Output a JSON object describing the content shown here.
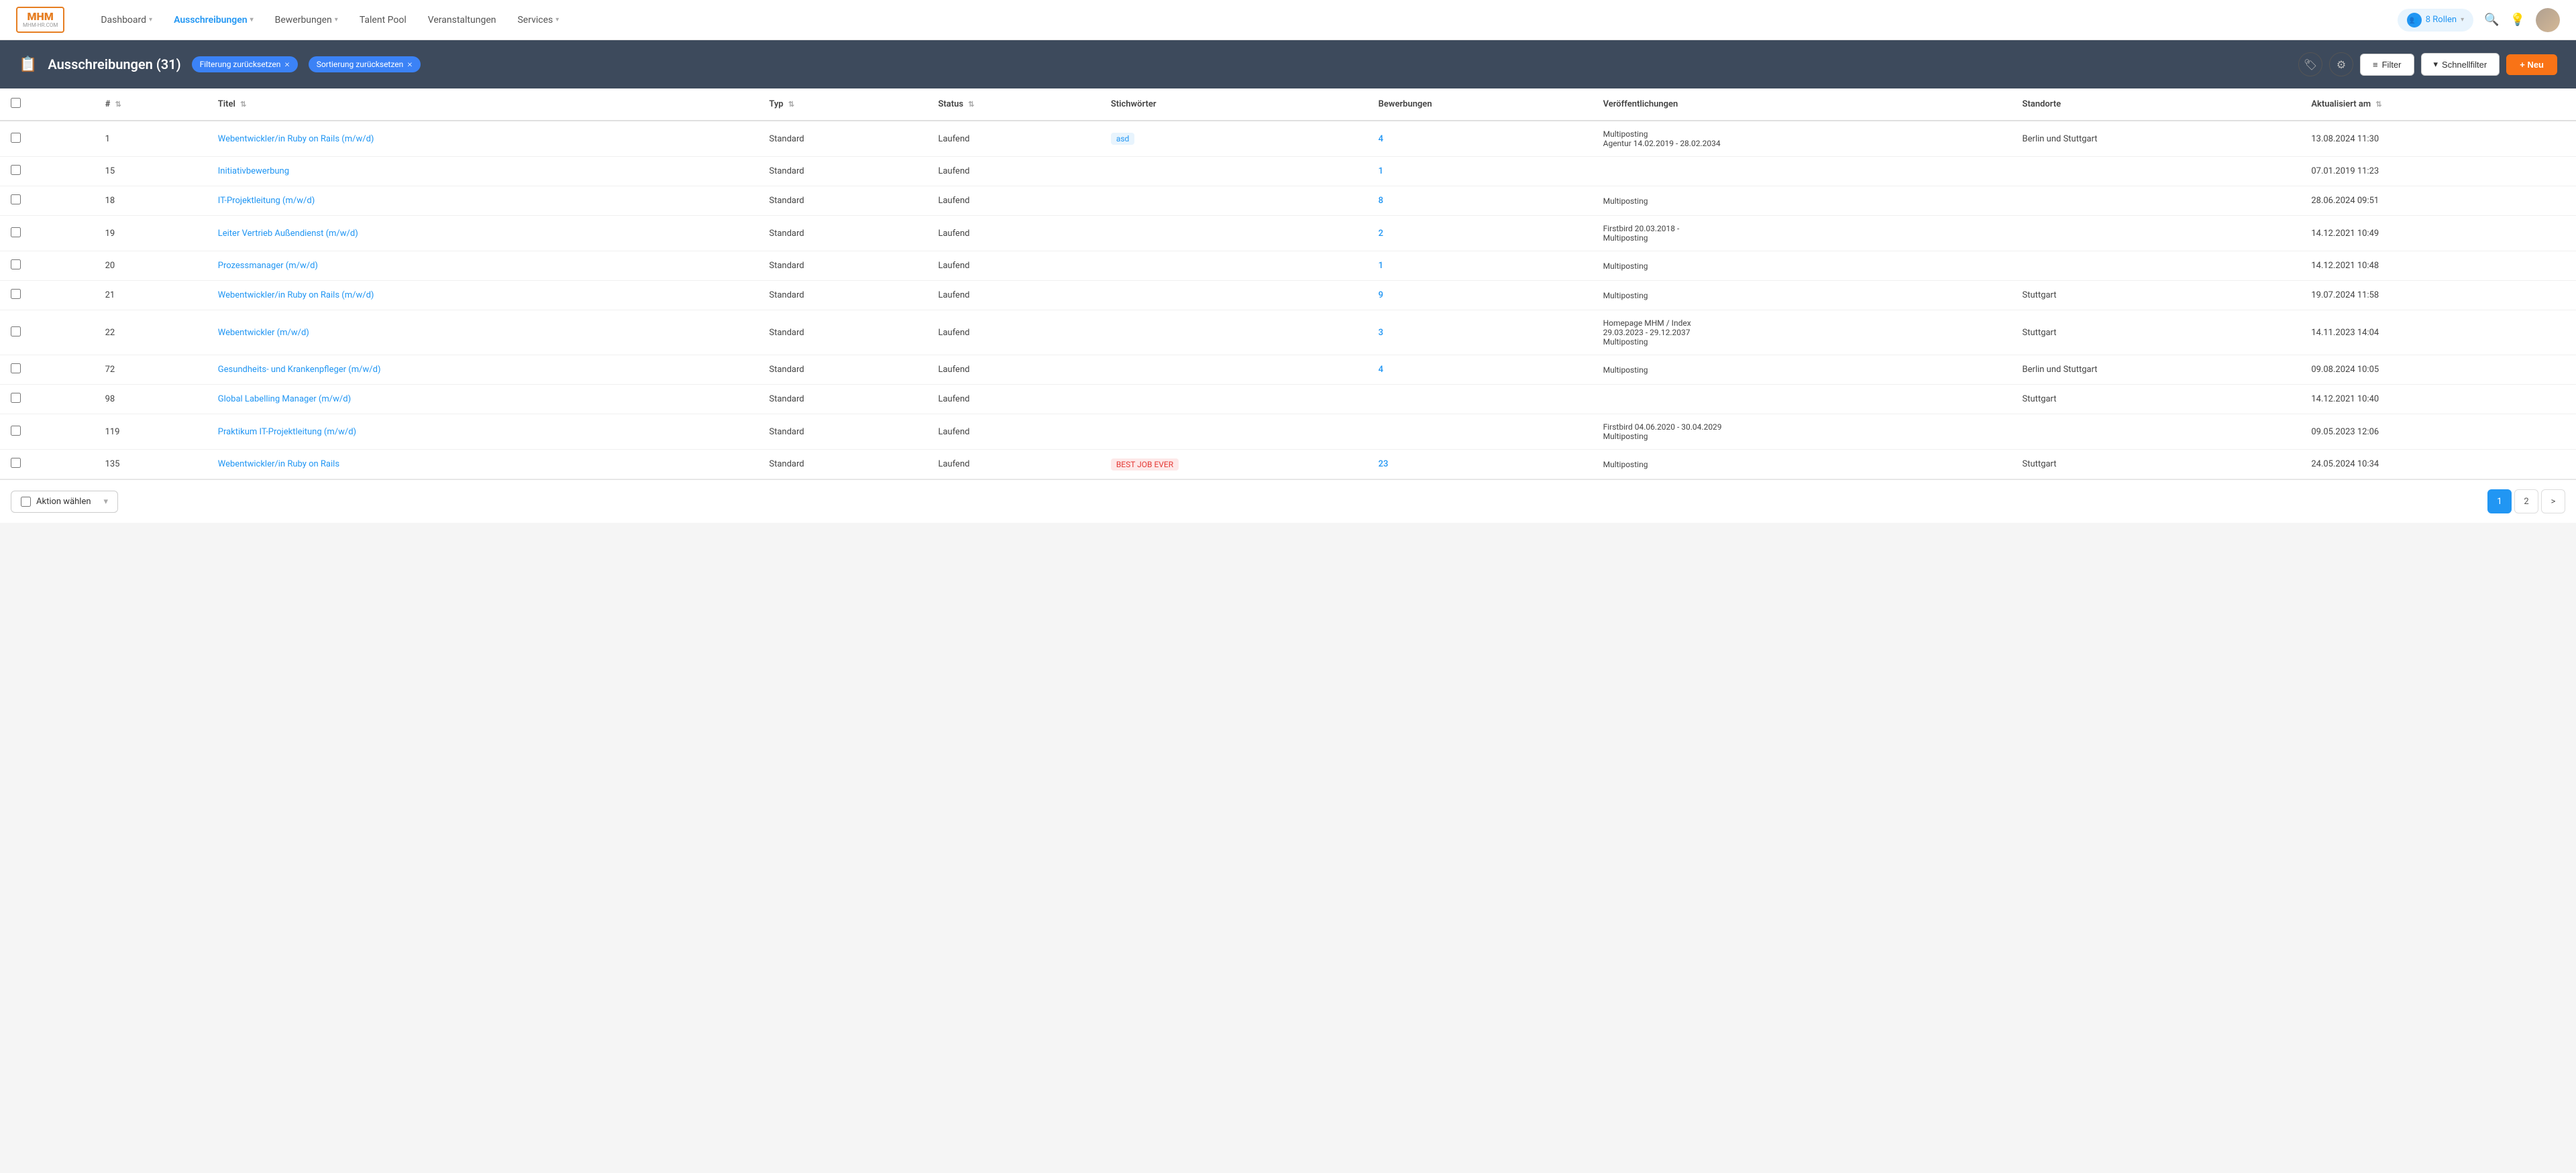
{
  "nav": {
    "logo_line1": "MHM",
    "logo_line2": "MHM-HR.COM",
    "links": [
      {
        "label": "Dashboard",
        "has_chevron": true,
        "active": false
      },
      {
        "label": "Ausschreibungen",
        "has_chevron": true,
        "active": true
      },
      {
        "label": "Bewerbungen",
        "has_chevron": true,
        "active": false
      },
      {
        "label": "Talent Pool",
        "has_chevron": false,
        "active": false
      },
      {
        "label": "Veranstaltungen",
        "has_chevron": false,
        "active": false
      },
      {
        "label": "Services",
        "has_chevron": true,
        "active": false
      }
    ],
    "roles_label": "8 Rollen"
  },
  "header": {
    "icon": "📋",
    "title": "Ausschreibungen (31)",
    "filter_reset_label": "Filterung zurücksetzen",
    "sort_reset_label": "Sortierung zurücksetzen",
    "filter_btn": "Filter",
    "schnell_btn": "Schnellfilter",
    "neu_btn": "+ Neu"
  },
  "table": {
    "columns": [
      "#",
      "Titel",
      "Typ",
      "Status",
      "Stichwörter",
      "Bewerbungen",
      "Veröffentlichungen",
      "Standorte",
      "Aktualisiert am"
    ],
    "rows": [
      {
        "id": "1",
        "title": "Webentwickler/in Ruby on Rails (m/w/d)",
        "typ": "Standard",
        "status": "Laufend",
        "stichwort": "asd",
        "stichwort_color": "blue",
        "bewerbungen": "4",
        "veroeffentlichungen": "Multiposting\nAgentur 14.02.2019 - 28.02.2034",
        "standorte": "Berlin und Stuttgart",
        "aktualisiert": "13.08.2024 11:30"
      },
      {
        "id": "15",
        "title": "Initiativbewerbung",
        "typ": "Standard",
        "status": "Laufend",
        "stichwort": "",
        "bewerbungen": "1",
        "veroeffentlichungen": "",
        "standorte": "",
        "aktualisiert": "07.01.2019 11:23"
      },
      {
        "id": "18",
        "title": "IT-Projektleitung (m/w/d)",
        "typ": "Standard",
        "status": "Laufend",
        "stichwort": "",
        "bewerbungen": "8",
        "veroeffentlichungen": "Multiposting",
        "standorte": "",
        "aktualisiert": "28.06.2024 09:51"
      },
      {
        "id": "19",
        "title": "Leiter Vertrieb Außendienst (m/w/d)",
        "typ": "Standard",
        "status": "Laufend",
        "stichwort": "",
        "bewerbungen": "2",
        "veroeffentlichungen": "Firstbird 20.03.2018 -\nMultiposting",
        "standorte": "",
        "aktualisiert": "14.12.2021 10:49"
      },
      {
        "id": "20",
        "title": "Prozessmanager (m/w/d)",
        "typ": "Standard",
        "status": "Laufend",
        "stichwort": "",
        "bewerbungen": "1",
        "veroeffentlichungen": "Multiposting",
        "standorte": "",
        "aktualisiert": "14.12.2021 10:48"
      },
      {
        "id": "21",
        "title": "Webentwickler/in Ruby on Rails (m/w/d)",
        "typ": "Standard",
        "status": "Laufend",
        "stichwort": "",
        "bewerbungen": "9",
        "veroeffentlichungen": "Multiposting",
        "standorte": "Stuttgart",
        "aktualisiert": "19.07.2024 11:58"
      },
      {
        "id": "22",
        "title": "Webentwickler (m/w/d)",
        "typ": "Standard",
        "status": "Laufend",
        "stichwort": "",
        "bewerbungen": "3",
        "veroeffentlichungen": "Homepage MHM / Index\n29.03.2023 - 29.12.2037\nMultiposting",
        "standorte": "Stuttgart",
        "aktualisiert": "14.11.2023 14:04"
      },
      {
        "id": "72",
        "title": "Gesundheits- und Krankenpfleger (m/w/d)",
        "typ": "Standard",
        "status": "Laufend",
        "stichwort": "",
        "bewerbungen": "4",
        "veroeffentlichungen": "Multiposting",
        "standorte": "Berlin und Stuttgart",
        "aktualisiert": "09.08.2024 10:05"
      },
      {
        "id": "98",
        "title": "Global Labelling Manager (m/w/d)",
        "typ": "Standard",
        "status": "Laufend",
        "stichwort": "",
        "bewerbungen": "",
        "veroeffentlichungen": "",
        "standorte": "Stuttgart",
        "aktualisiert": "14.12.2021 10:40"
      },
      {
        "id": "119",
        "title": "Praktikum IT-Projektleitung (m/w/d)",
        "typ": "Standard",
        "status": "Laufend",
        "stichwort": "",
        "bewerbungen": "",
        "veroeffentlichungen": "Firstbird 04.06.2020 - 30.04.2029\nMultiposting",
        "standorte": "",
        "aktualisiert": "09.05.2023 12:06"
      },
      {
        "id": "135",
        "title": "Webentwickler/in Ruby on Rails",
        "typ": "Standard",
        "status": "Laufend",
        "stichwort": "BEST JOB EVER",
        "stichwort_color": "red",
        "bewerbungen": "23",
        "veroeffentlichungen": "Multiposting",
        "standorte": "Stuttgart",
        "aktualisiert": "24.05.2024 10:34"
      }
    ]
  },
  "footer": {
    "action_placeholder": "Aktion wählen",
    "pages": [
      "1",
      "2"
    ],
    "next_label": ">"
  }
}
